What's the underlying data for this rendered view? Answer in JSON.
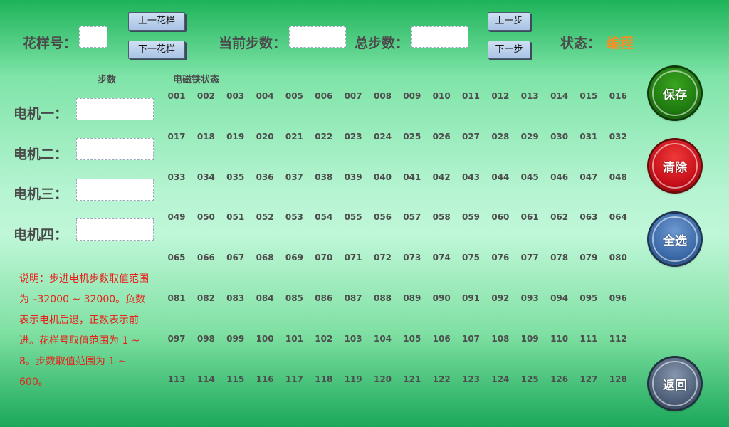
{
  "header": {
    "pattern_label": "花样号：",
    "pattern_value": "",
    "prev_pattern": "上一花样",
    "next_pattern": "下一花样",
    "current_step_label": "当前步数：",
    "current_step_value": "",
    "total_steps_label": "总步数：",
    "total_steps_value": "",
    "prev_step": "上一步",
    "next_step": "下一步",
    "status_label": "状态：",
    "status_value": "编程"
  },
  "columns": {
    "steps": "步数",
    "magnet": "电磁铁状态"
  },
  "motors": [
    {
      "label": "电机一：",
      "value": ""
    },
    {
      "label": "电机二：",
      "value": ""
    },
    {
      "label": "电机三：",
      "value": ""
    },
    {
      "label": "电机四：",
      "value": ""
    }
  ],
  "help_text": "说明：步进电机步数取值范围为 –32000 ~ 32000。负数表示电机后退，正数表示前进。花样号取值范围为 1 ~ 8。步数取值范围为 1 ~ 600。",
  "actions": {
    "save": "保存",
    "clear": "清除",
    "select_all": "全选",
    "back": "返回"
  },
  "magnets": [
    "001",
    "002",
    "003",
    "004",
    "005",
    "006",
    "007",
    "008",
    "009",
    "010",
    "011",
    "012",
    "013",
    "014",
    "015",
    "016",
    "017",
    "018",
    "019",
    "020",
    "021",
    "022",
    "023",
    "024",
    "025",
    "026",
    "027",
    "028",
    "029",
    "030",
    "031",
    "032",
    "033",
    "034",
    "035",
    "036",
    "037",
    "038",
    "039",
    "040",
    "041",
    "042",
    "043",
    "044",
    "045",
    "046",
    "047",
    "048",
    "049",
    "050",
    "051",
    "052",
    "053",
    "054",
    "055",
    "056",
    "057",
    "058",
    "059",
    "060",
    "061",
    "062",
    "063",
    "064",
    "065",
    "066",
    "067",
    "068",
    "069",
    "070",
    "071",
    "072",
    "073",
    "074",
    "075",
    "076",
    "077",
    "078",
    "079",
    "080",
    "081",
    "082",
    "083",
    "084",
    "085",
    "086",
    "087",
    "088",
    "089",
    "090",
    "091",
    "092",
    "093",
    "094",
    "095",
    "096",
    "097",
    "098",
    "099",
    "100",
    "101",
    "102",
    "103",
    "104",
    "105",
    "106",
    "107",
    "108",
    "109",
    "110",
    "111",
    "112",
    "113",
    "114",
    "115",
    "116",
    "117",
    "118",
    "119",
    "120",
    "121",
    "122",
    "123",
    "124",
    "125",
    "126",
    "127",
    "128"
  ],
  "colors": {
    "status": "#ff8a1e",
    "help": "#e8201a",
    "save": "#1f7a10",
    "clear": "#c8101a",
    "select_all": "#3b6aa8",
    "back": "#4d5f78"
  }
}
